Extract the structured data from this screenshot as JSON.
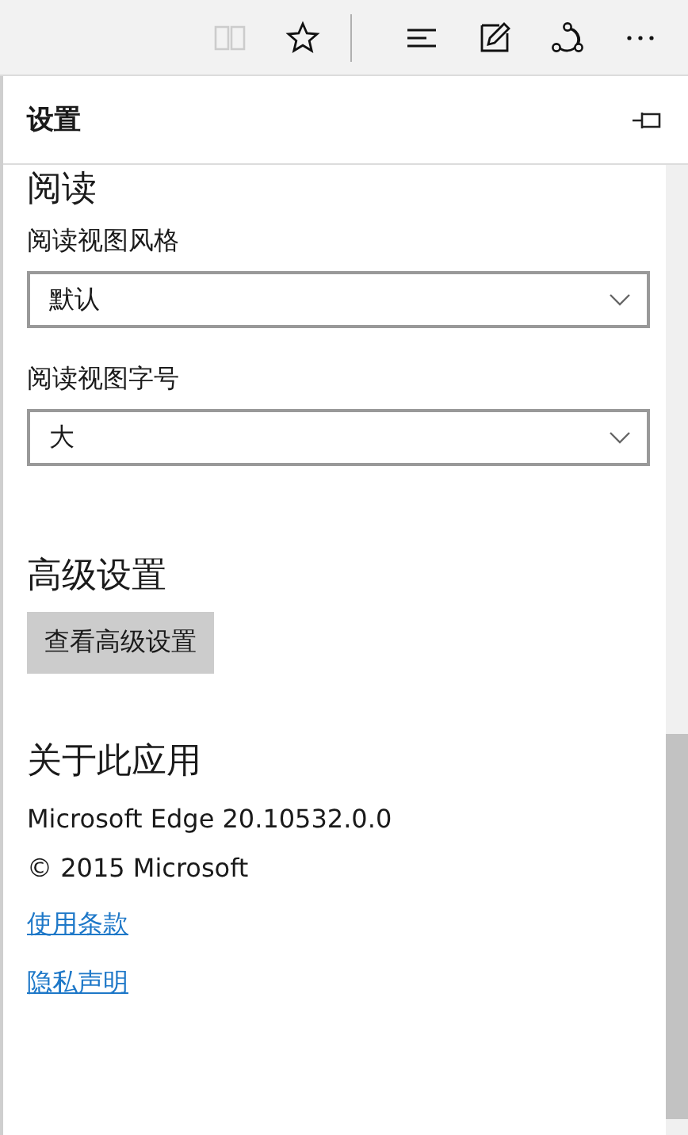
{
  "toolbar": [
    {
      "kind": "reading-view",
      "disabled": true
    },
    {
      "kind": "favorite",
      "disabled": false
    },
    {
      "kind": "divider"
    },
    {
      "kind": "hub",
      "disabled": false
    },
    {
      "kind": "note",
      "disabled": false
    },
    {
      "kind": "share",
      "disabled": false
    },
    {
      "kind": "more",
      "disabled": false
    }
  ],
  "panel": {
    "title": "设置",
    "sections": [
      {
        "heading": "阅读",
        "items": [
          {
            "kind": "select",
            "label": "阅读视图风格",
            "value": "默认"
          },
          {
            "kind": "select",
            "label": "阅读视图字号",
            "value": "大"
          }
        ]
      },
      {
        "heading": "高级设置",
        "items": [
          {
            "kind": "button",
            "label": "查看高级设置"
          }
        ]
      },
      {
        "heading": "关于此应用",
        "items": [
          {
            "kind": "text",
            "label": "Microsoft Edge 20.10532.0.0"
          },
          {
            "kind": "text",
            "label": "© 2015 Microsoft"
          },
          {
            "kind": "link",
            "label": "使用条款"
          },
          {
            "kind": "link",
            "label": "隐私声明"
          }
        ]
      }
    ]
  }
}
